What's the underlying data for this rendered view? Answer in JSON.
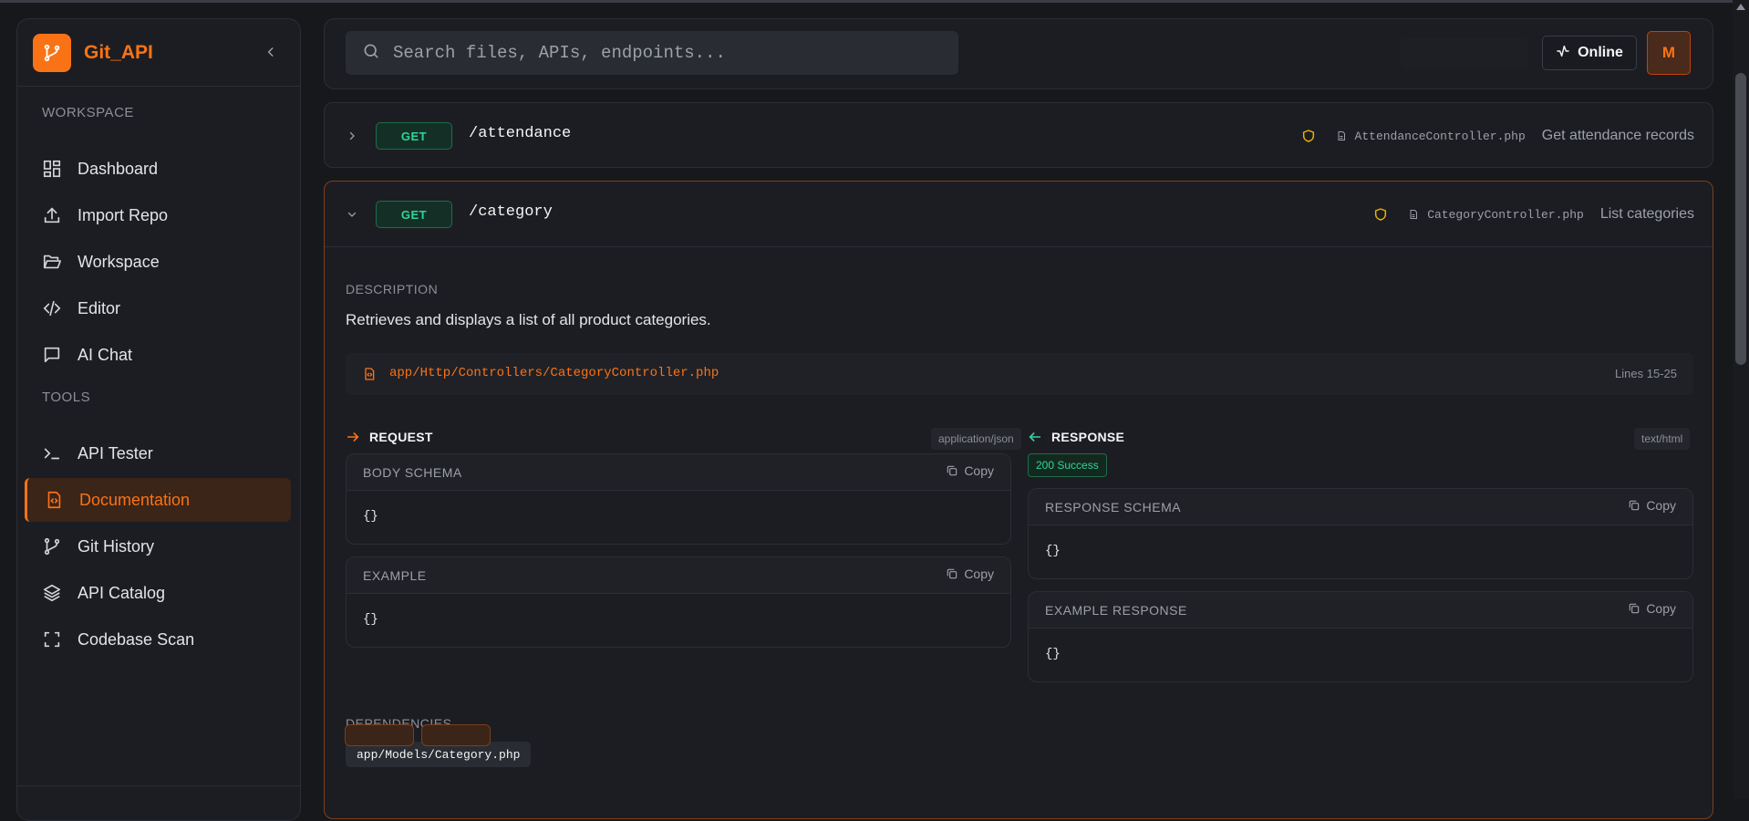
{
  "brand": {
    "name": "Git_API"
  },
  "sidebar": {
    "sections": [
      {
        "label": "WORKSPACE"
      },
      {
        "label": "TOOLS"
      }
    ],
    "items": [
      {
        "label": "Dashboard",
        "icon": "grid-icon"
      },
      {
        "label": "Import Repo",
        "icon": "upload-icon"
      },
      {
        "label": "Workspace",
        "icon": "folder-open-icon"
      },
      {
        "label": "Editor",
        "icon": "code-icon"
      },
      {
        "label": "AI Chat",
        "icon": "message-icon"
      },
      {
        "label": "API Tester",
        "icon": "terminal-icon"
      },
      {
        "label": "Documentation",
        "icon": "file-code-icon",
        "active": true
      },
      {
        "label": "Git History",
        "icon": "git-branch-icon"
      },
      {
        "label": "API Catalog",
        "icon": "layers-icon"
      },
      {
        "label": "Codebase Scan",
        "icon": "scan-icon"
      }
    ]
  },
  "header": {
    "search_placeholder": "Search files, APIs, endpoints...",
    "status_label": "Online",
    "avatar_initial": "M"
  },
  "endpoints": [
    {
      "method": "GET",
      "path": "/attendance",
      "controller": "AttendanceController.php",
      "summary": "Get attendance records",
      "expanded": false
    },
    {
      "method": "GET",
      "path": "/category",
      "controller": "CategoryController.php",
      "summary": "List categories",
      "expanded": true,
      "description_label": "DESCRIPTION",
      "description": "Retrieves and displays a list of all product categories.",
      "file_path": "app/Http/Controllers/CategoryController.php",
      "lines": "Lines 15-25",
      "request": {
        "title": "REQUEST",
        "content_type": "application/json",
        "body_schema_label": "BODY SCHEMA",
        "body_schema": "{}",
        "example_label": "EXAMPLE",
        "example": "{}"
      },
      "response": {
        "title": "RESPONSE",
        "content_type": "text/html",
        "status": "200 Success",
        "schema_label": "RESPONSE SCHEMA",
        "schema": "{}",
        "example_label": "EXAMPLE RESPONSE",
        "example": "{}"
      },
      "copy_label": "Copy",
      "dependencies_label": "DEPENDENCIES",
      "dependencies": [
        "app/Models/Category.php"
      ]
    }
  ],
  "colors": {
    "accent": "#f97316",
    "get_method": "#34d399",
    "background": "#17181c",
    "panel": "#1c1d22"
  }
}
